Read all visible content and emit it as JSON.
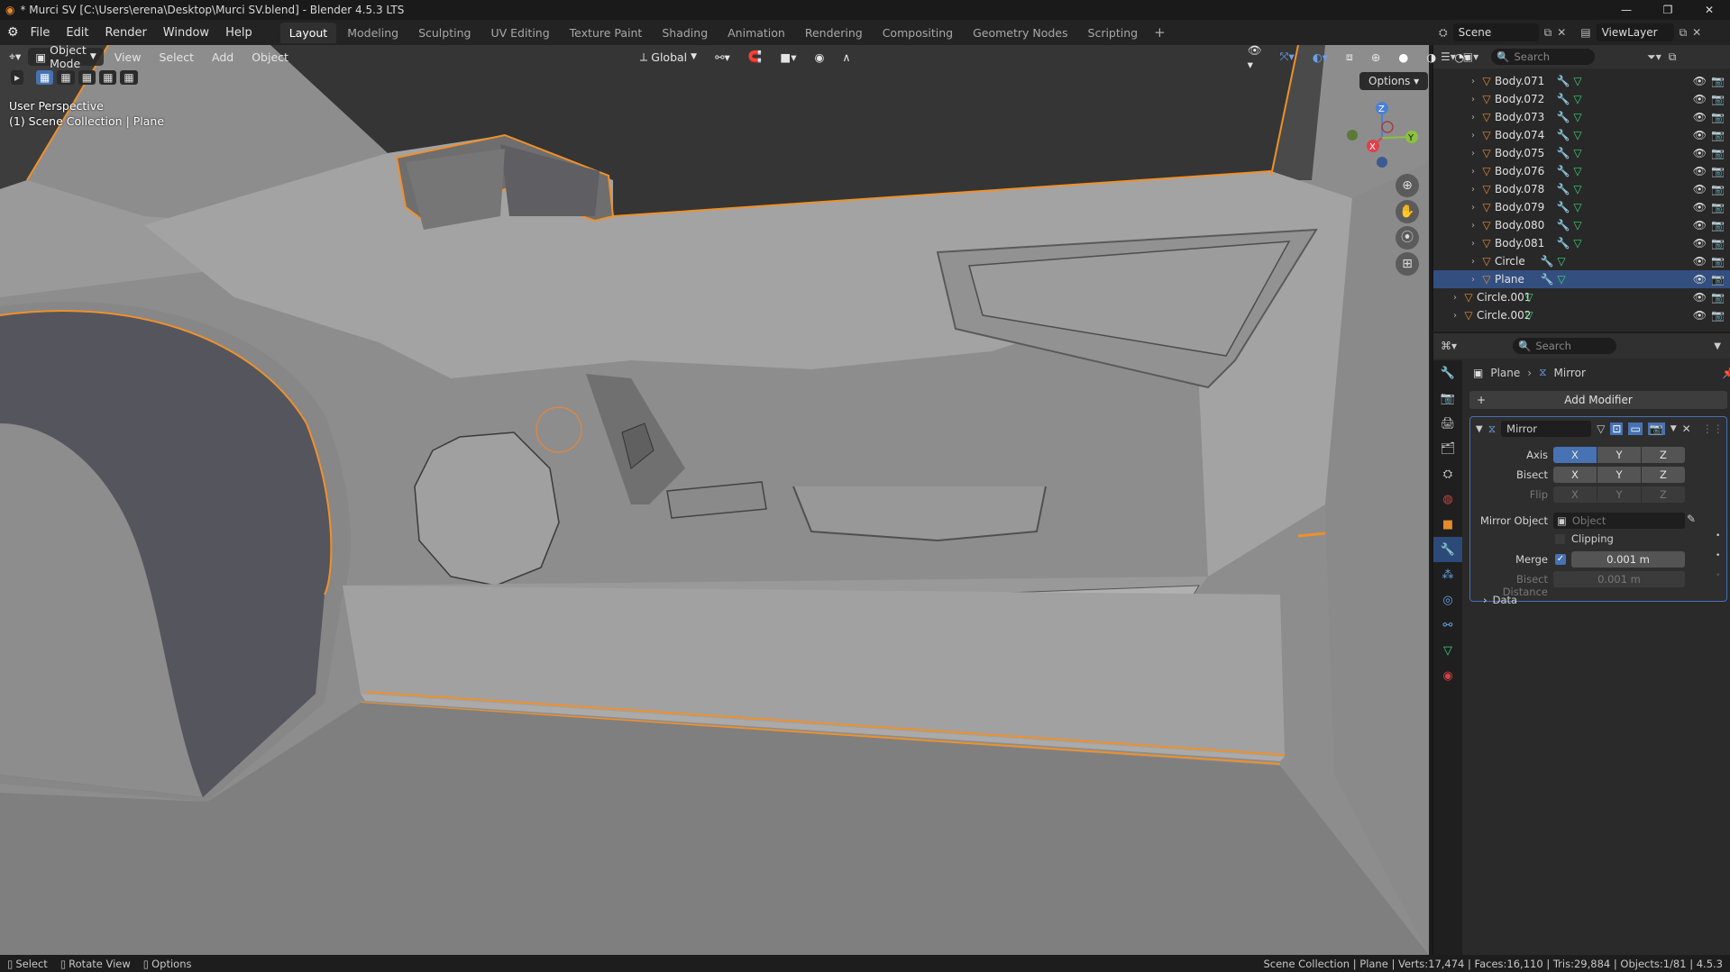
{
  "window": {
    "title": "* Murci SV [C:\\Users\\erena\\Desktop\\Murci SV.blend] - Blender 4.5.3 LTS"
  },
  "menu": [
    "File",
    "Edit",
    "Render",
    "Window",
    "Help"
  ],
  "workspaces": [
    "Layout",
    "Modeling",
    "Sculpting",
    "UV Editing",
    "Texture Paint",
    "Shading",
    "Animation",
    "Rendering",
    "Compositing",
    "Geometry Nodes",
    "Scripting"
  ],
  "active_workspace": "Layout",
  "scene": {
    "name": "Scene",
    "view_layer": "ViewLayer"
  },
  "viewport": {
    "mode": "Object Mode",
    "menus": [
      "View",
      "Select",
      "Add",
      "Object"
    ],
    "orientation": "Global",
    "options_label": "Options",
    "perspective_label": "User Perspective",
    "collection_label": "(1) Scene Collection | Plane",
    "gizmo_axes": [
      "Z",
      "Y",
      "X"
    ]
  },
  "outliner": {
    "search_placeholder": "Search",
    "items": [
      {
        "name": "Body.071",
        "selected": false
      },
      {
        "name": "Body.072",
        "selected": false
      },
      {
        "name": "Body.073",
        "selected": false
      },
      {
        "name": "Body.074",
        "selected": false
      },
      {
        "name": "Body.075",
        "selected": false
      },
      {
        "name": "Body.076",
        "selected": false
      },
      {
        "name": "Body.078",
        "selected": false
      },
      {
        "name": "Body.079",
        "selected": false
      },
      {
        "name": "Body.080",
        "selected": false
      },
      {
        "name": "Body.081",
        "selected": false
      },
      {
        "name": "Circle",
        "selected": false
      },
      {
        "name": "Plane",
        "selected": true
      },
      {
        "name": "Circle.001",
        "selected": false
      },
      {
        "name": "Circle.002",
        "selected": false
      }
    ]
  },
  "properties": {
    "search_placeholder": "Search",
    "breadcrumb_object": "Plane",
    "breadcrumb_modifier": "Mirror",
    "add_modifier_label": "Add Modifier",
    "modifier_name": "Mirror",
    "axis_label": "Axis",
    "bisect_label": "Bisect",
    "flip_label": "Flip",
    "axis_buttons": [
      "X",
      "Y",
      "Z"
    ],
    "mirror_object_label": "Mirror Object",
    "mirror_object_placeholder": "Object",
    "clipping_label": "Clipping",
    "merge_label": "Merge",
    "merge_value": "0.001 m",
    "bisect_distance_label": "Bisect Distance",
    "bisect_distance_value": "0.001 m",
    "data_label": "Data",
    "axis_active": "X",
    "merge_checked": true,
    "clipping_checked": false
  },
  "statusbar": {
    "select": "Select",
    "rotate": "Rotate View",
    "options": "Options",
    "stats": "Scene Collection | Plane | Verts:17,474 | Faces:16,110 | Tris:29,884 | Objects:1/81 | 4.5.3"
  },
  "colors": {
    "selection_outline": "#f0902a",
    "active_row": "#334f80",
    "axis_on": "#4772b3"
  }
}
